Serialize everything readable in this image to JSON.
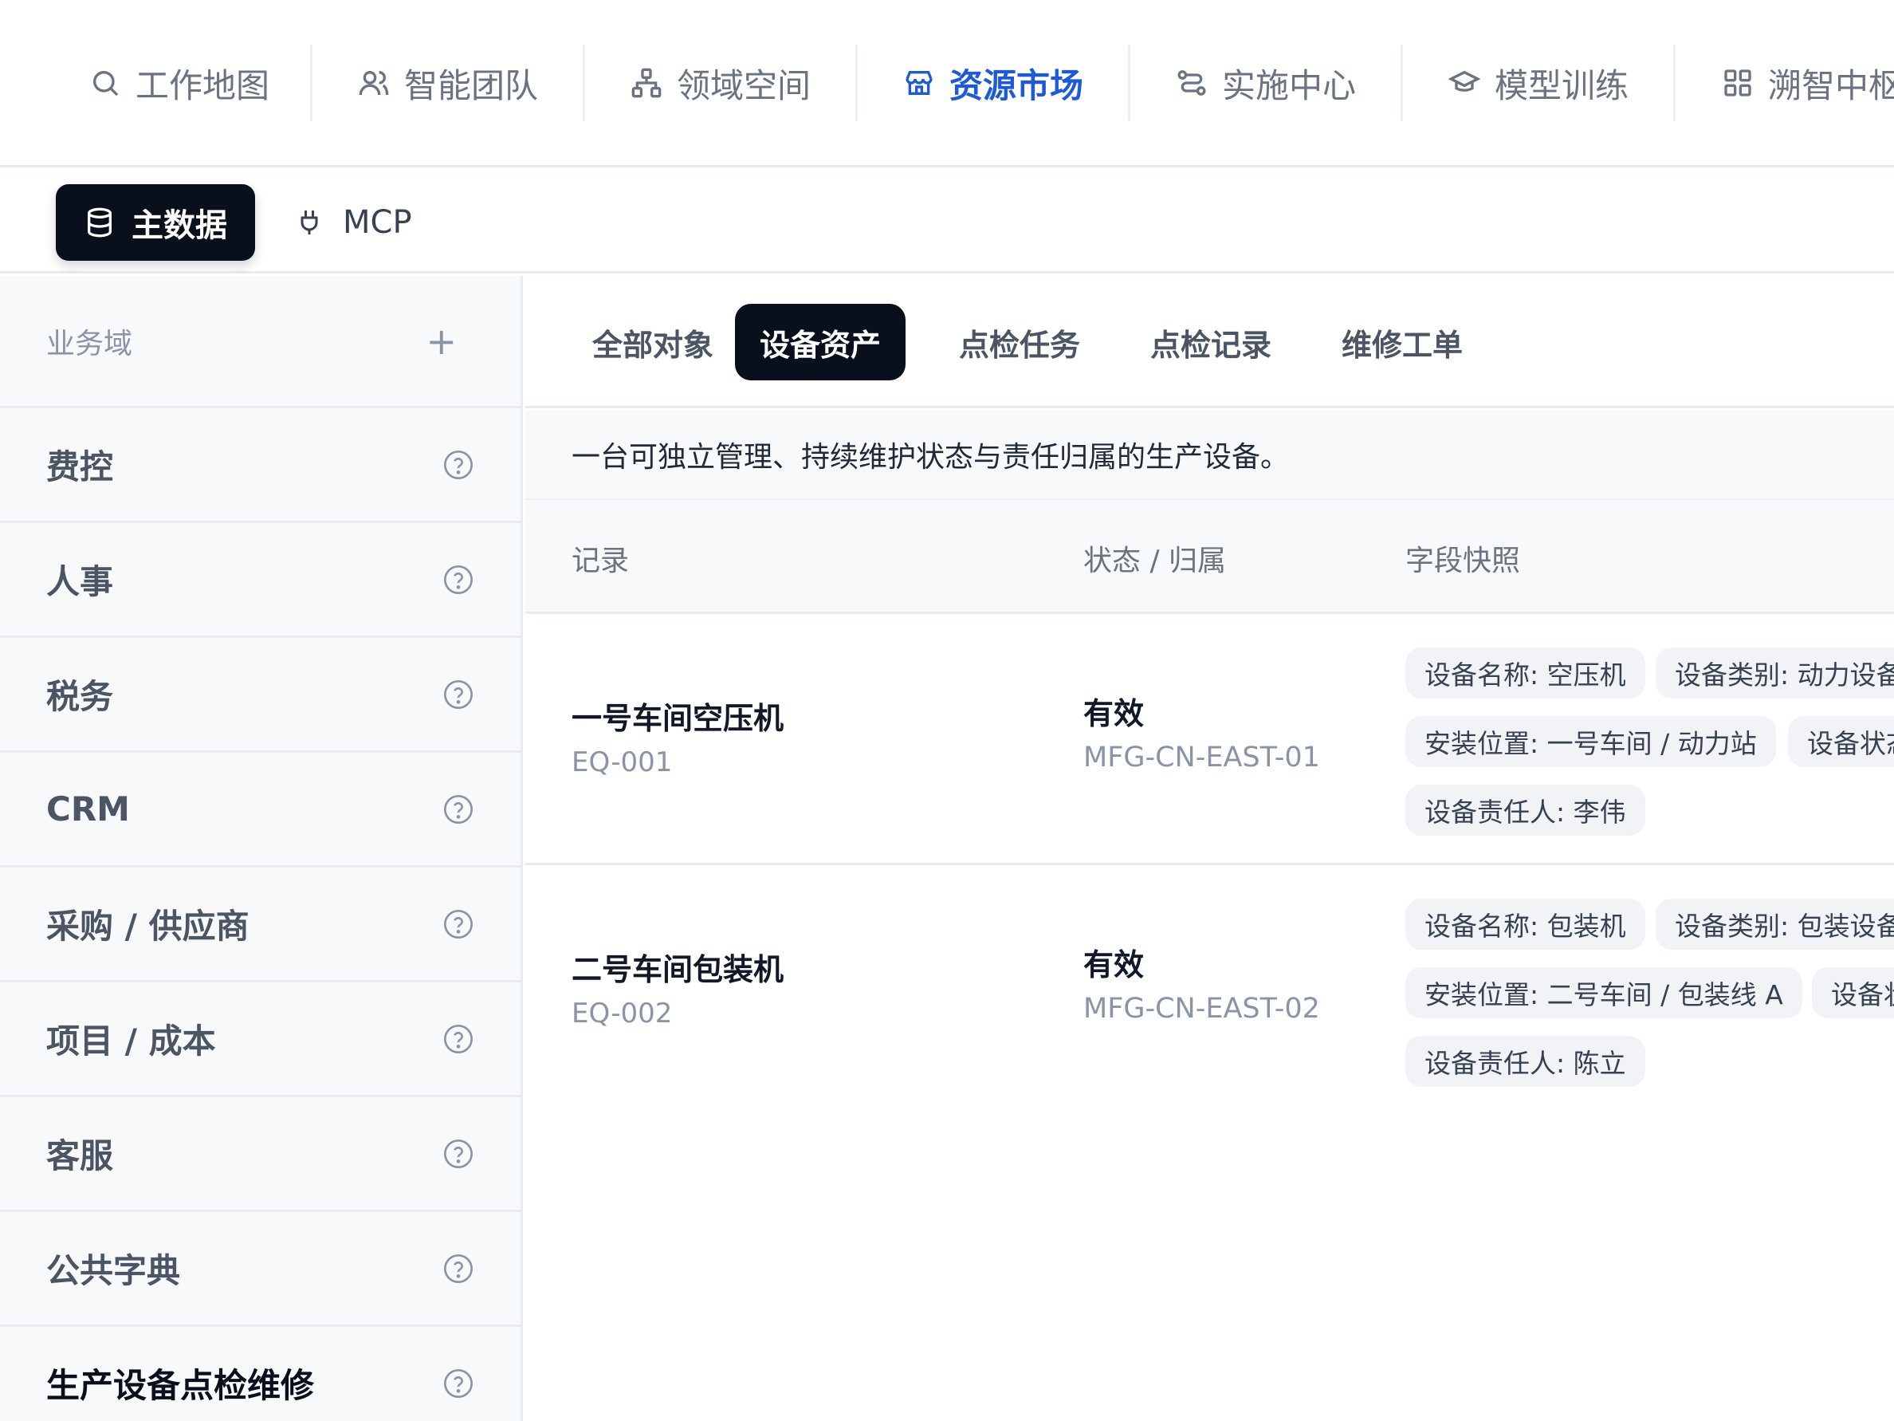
{
  "top_nav": {
    "items": [
      {
        "label": "工作地图",
        "icon": "search-icon"
      },
      {
        "label": "智能团队",
        "icon": "users-icon"
      },
      {
        "label": "领域空间",
        "icon": "network-icon"
      },
      {
        "label": "资源市场",
        "icon": "store-icon",
        "active": true
      },
      {
        "label": "实施中心",
        "icon": "route-icon"
      },
      {
        "label": "模型训练",
        "icon": "graduation-cap-icon"
      },
      {
        "label": "溯智中枢",
        "icon": "grid-icon"
      }
    ]
  },
  "sub_nav": {
    "primary": {
      "label": "主数据",
      "icon": "database-icon"
    },
    "secondary": {
      "label": "MCP",
      "icon": "plug-icon"
    }
  },
  "sidebar": {
    "header": "业务域",
    "add": "+",
    "items": [
      {
        "label": "费控"
      },
      {
        "label": "人事"
      },
      {
        "label": "税务"
      },
      {
        "label": "CRM"
      },
      {
        "label": "采购 / 供应商"
      },
      {
        "label": "项目 / 成本"
      },
      {
        "label": "客服"
      },
      {
        "label": "公共字典"
      },
      {
        "label": "生产设备点检维修",
        "active": true
      }
    ]
  },
  "main": {
    "tabs": [
      {
        "label": "全部对象"
      },
      {
        "label": "设备资产",
        "active": true
      },
      {
        "label": "点检任务"
      },
      {
        "label": "点检记录"
      },
      {
        "label": "维修工单"
      }
    ],
    "description": "一台可独立管理、持续维护状态与责任归属的生产设备。",
    "columns": {
      "record": "记录",
      "status": "状态 / 归属",
      "snapshot": "字段快照"
    },
    "rows": [
      {
        "title": "一号车间空压机",
        "code": "EQ-001",
        "status": "有效",
        "owner": "MFG-CN-EAST-01",
        "chips": [
          "设备名称: 空压机",
          "设备类别: 动力设备",
          "安装位置: 一号车间 / 动力站",
          "设备状态",
          "设备责任人: 李伟"
        ]
      },
      {
        "title": "二号车间包装机",
        "code": "EQ-002",
        "status": "有效",
        "owner": "MFG-CN-EAST-02",
        "chips": [
          "设备名称: 包装机",
          "设备类别: 包装设备",
          "安装位置: 二号车间 / 包装线 A",
          "设备状态",
          "设备责任人: 陈立"
        ]
      }
    ]
  },
  "colors": {
    "accent": "#1d5ad9",
    "dark": "#0a0f1c",
    "muted": "#8a94a6",
    "border": "#e8ebf0"
  }
}
